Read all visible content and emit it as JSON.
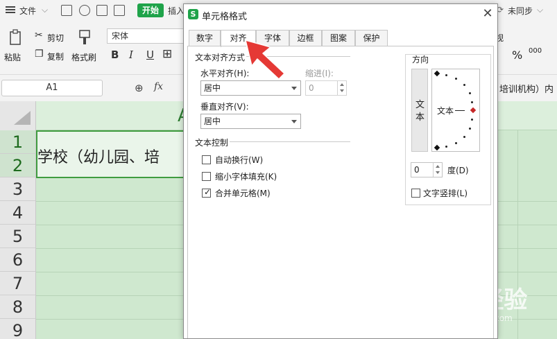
{
  "titlebar": {
    "file_menu": "文件",
    "start_tab": "开始",
    "insert_tab": "插入",
    "sync_status": "未同步"
  },
  "ribbon": {
    "paste": "粘贴",
    "cut": "剪切",
    "copy": "复制",
    "format_painter": "格式刷",
    "font_name": "宋体",
    "view_tab_partial": "视",
    "percent": "%",
    "thousands": "000"
  },
  "formula_bar": {
    "name_box": "A1",
    "fx": "fx",
    "content_tail": "培训机构）内"
  },
  "sheet": {
    "column_header": "A",
    "rows": [
      "1",
      "2",
      "3",
      "4",
      "5",
      "6",
      "7",
      "8",
      "9"
    ],
    "merged_cell_text": "学校（幼儿园、培"
  },
  "watermark": {
    "main": "Bai 经验",
    "sub": "jingyan.baidu.com"
  },
  "dialog": {
    "title": "单元格格式",
    "logo": "S",
    "tabs": [
      "数字",
      "对齐",
      "字体",
      "边框",
      "图案",
      "保护"
    ],
    "active_tab": "对齐",
    "alignment": {
      "group_label": "文本对齐方式",
      "horizontal_label": "水平对齐(H):",
      "horizontal_value": "居中",
      "indent_label": "缩进(I):",
      "indent_value": "0",
      "vertical_label": "垂直对齐(V):",
      "vertical_value": "居中"
    },
    "text_control": {
      "group_label": "文本控制",
      "wrap_text": {
        "label": "自动换行(W)",
        "checked": false
      },
      "shrink_to_fit": {
        "label": "缩小字体填充(K)",
        "checked": false
      },
      "merge_cells": {
        "label": "合并单元格(M)",
        "checked": true
      }
    },
    "orientation": {
      "group_label": "方向",
      "vertical_text": [
        "文",
        "本"
      ],
      "dial_text": "文本",
      "degrees_value": "0",
      "degrees_label": "度(D)",
      "vertical_text_check": {
        "label": "文字竖排(L)",
        "checked": false
      }
    }
  },
  "colors": {
    "accent_green": "#1fa34a",
    "sheet_bg": "#cfe8cf",
    "arrow_red": "#e53935"
  }
}
